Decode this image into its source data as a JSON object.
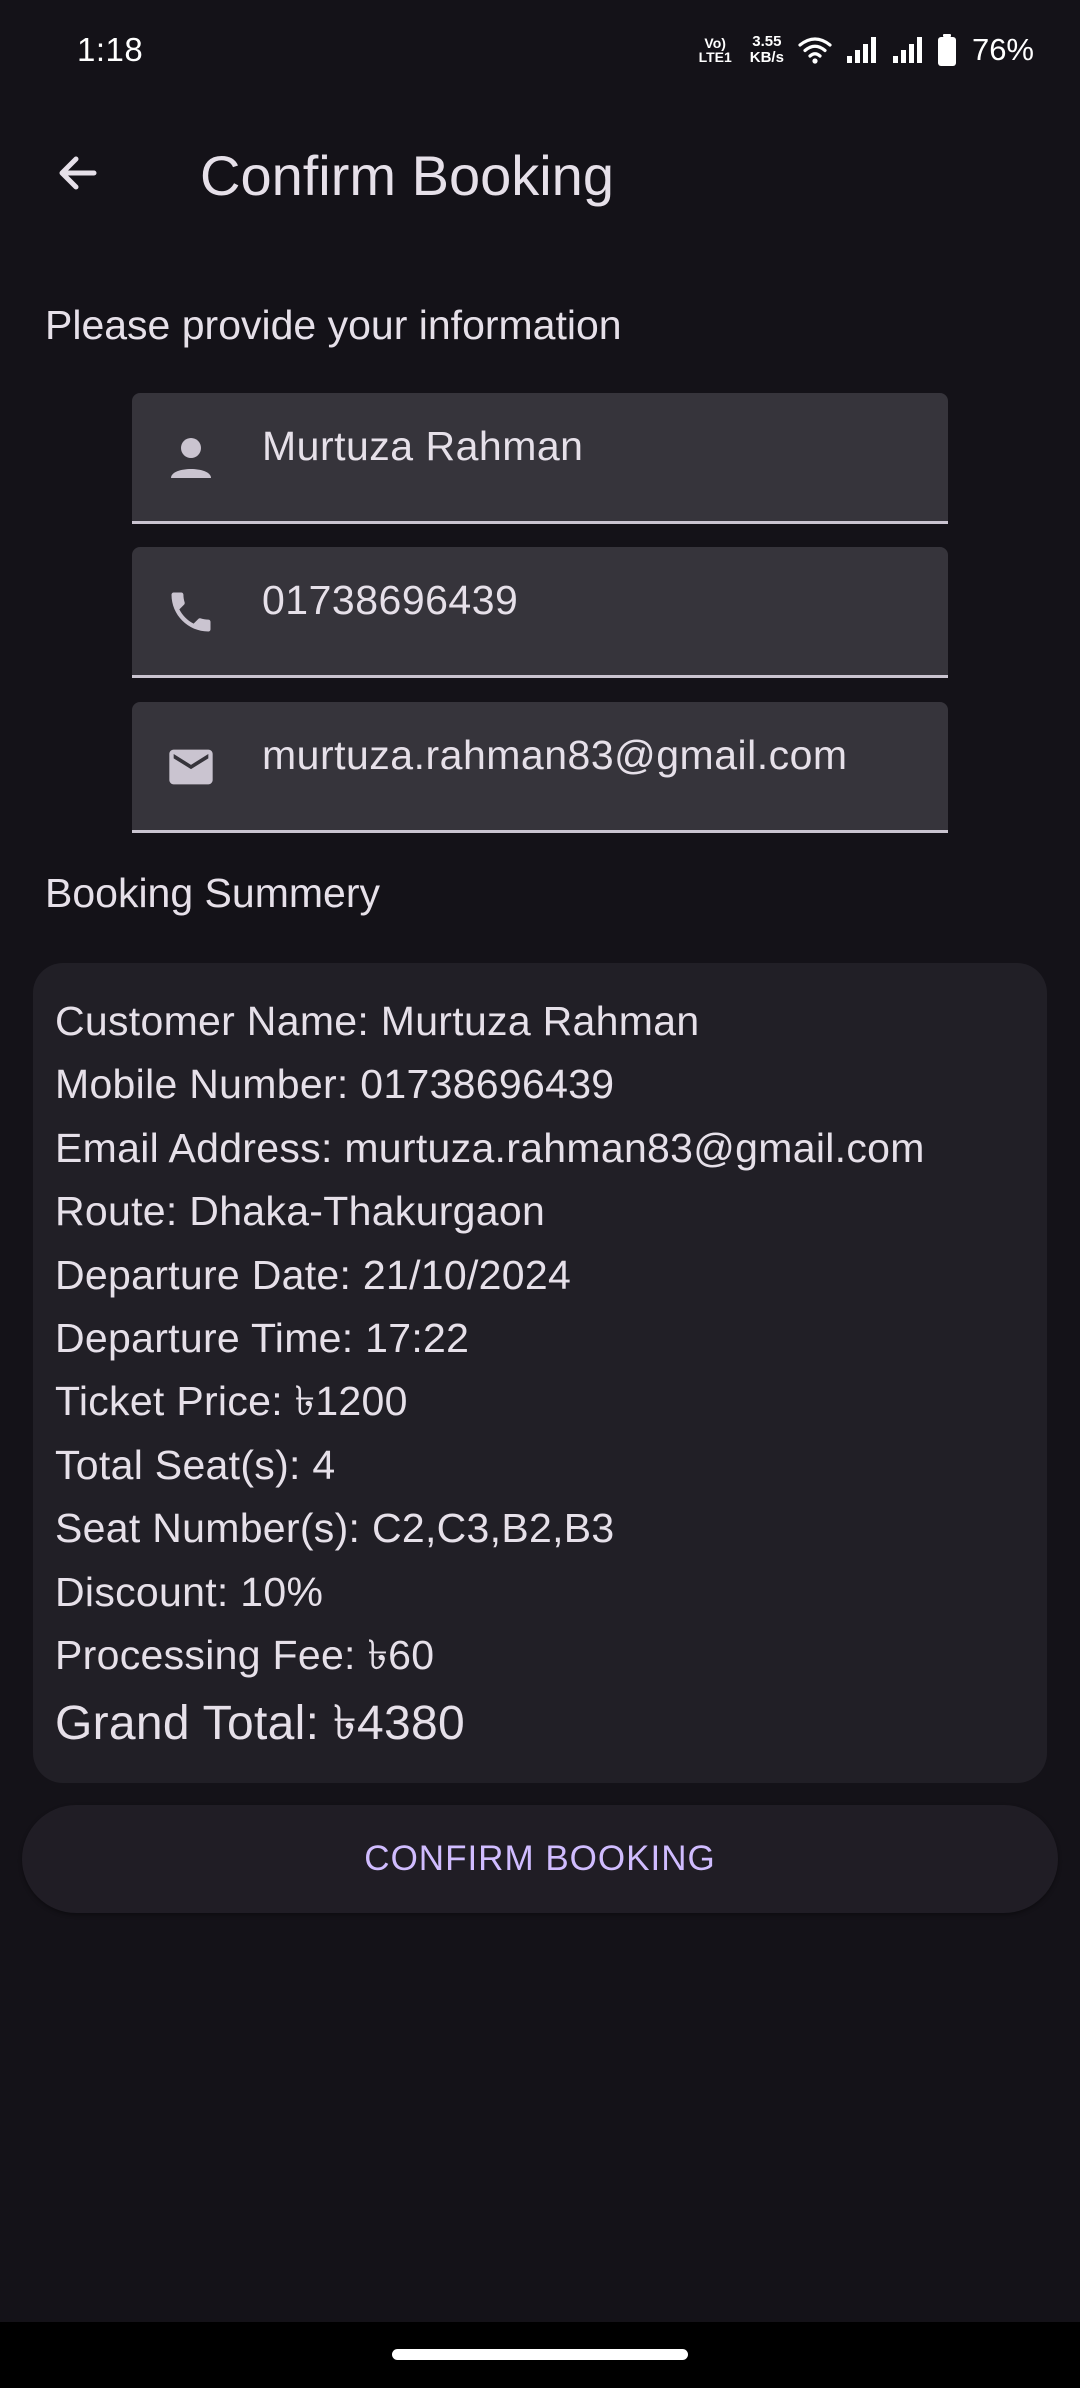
{
  "status_bar": {
    "time": "1:18",
    "volte_top": "Vo)",
    "volte_bottom": "LTE1",
    "speed_value": "3.55",
    "speed_unit": "KB/s",
    "battery": "76%"
  },
  "app_bar": {
    "title": "Confirm Booking"
  },
  "info_section": {
    "heading": "Please provide your information",
    "name_value": "Murtuza Rahman",
    "phone_value": "01738696439",
    "email_value": "murtuza.rahman83@gmail.com"
  },
  "summary": {
    "heading": "Booking Summery",
    "lines": [
      "Customer Name: Murtuza Rahman",
      "Mobile Number: 01738696439",
      "Email Address: murtuza.rahman83@gmail.com",
      "Route: Dhaka-Thakurgaon",
      "Departure Date: 21/10/2024",
      "Departure Time: 17:22",
      "Ticket Price: ৳1200",
      "Total Seat(s): 4",
      "Seat Number(s): C2,C3,B2,B3",
      "Discount: 10%",
      "Processing Fee: ৳60"
    ],
    "grand_total": "Grand Total: ৳4380"
  },
  "confirm_button": {
    "label": "CONFIRM BOOKING"
  },
  "icons": {
    "back": "arrow-back-icon",
    "person": "person-icon",
    "phone": "phone-icon",
    "email": "email-icon"
  },
  "colors": {
    "background": "#141218",
    "field_bg": "#36343b",
    "card_bg": "#211f26",
    "accent": "#d0bcff",
    "text": "#e6e0e9"
  }
}
